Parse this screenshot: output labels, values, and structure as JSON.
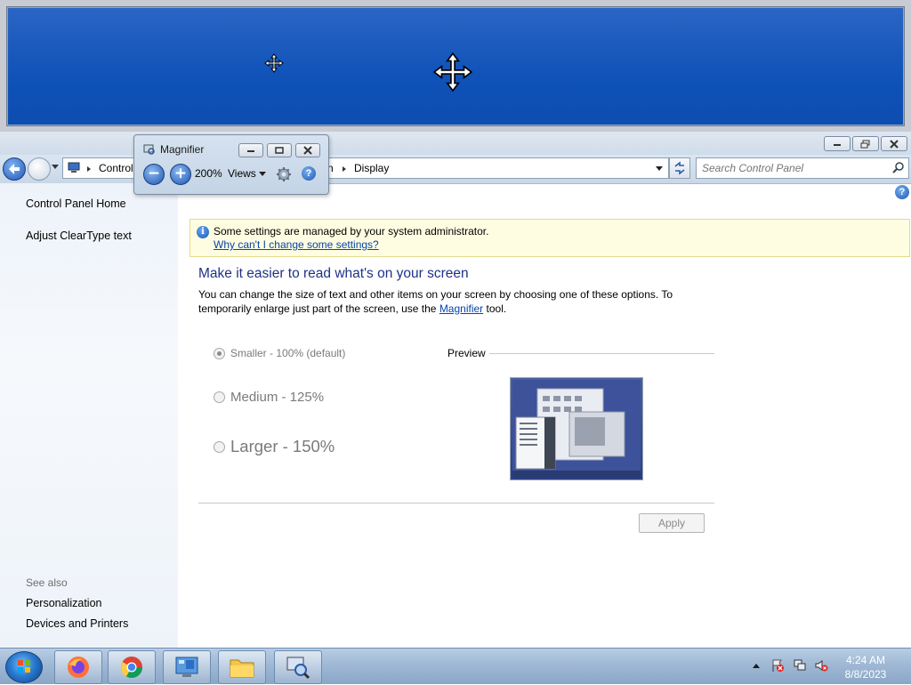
{
  "magnifier": {
    "title": "Magnifier",
    "zoom": "200%",
    "views_label": "Views"
  },
  "window": {
    "address": {
      "crumb_start": "Control",
      "crumb_tail_fragment": "n",
      "crumb_end": "Display"
    },
    "search_placeholder": "Search Control Panel"
  },
  "left_panel": {
    "home": "Control Panel Home",
    "cleartype": "Adjust ClearType text",
    "see_also_label": "See also",
    "see_also": [
      "Personalization",
      "Devices and Printers"
    ]
  },
  "main": {
    "info_text": "Some settings are managed by your system administrator.",
    "info_link": "Why can't I change some settings?",
    "heading": "Make it easier to read what's on your screen",
    "desc_part1": "You can change the size of text and other items on your screen by choosing one of these options. To temporarily enlarge just part of the screen, use the ",
    "desc_link": "Magnifier",
    "desc_part2": " tool.",
    "options": [
      {
        "label": "Smaller - 100% (default)",
        "selected": true
      },
      {
        "label": "Medium - 125%",
        "selected": false
      },
      {
        "label": "Larger - 150%",
        "selected": false
      }
    ],
    "preview_label": "Preview",
    "apply_label": "Apply"
  },
  "taskbar": {
    "time": "4:24 AM",
    "date": "8/8/2023",
    "pinned": [
      "firefox-icon",
      "chrome-icon",
      "control-panel-icon",
      "file-explorer-icon",
      "magnifier-icon"
    ]
  }
}
